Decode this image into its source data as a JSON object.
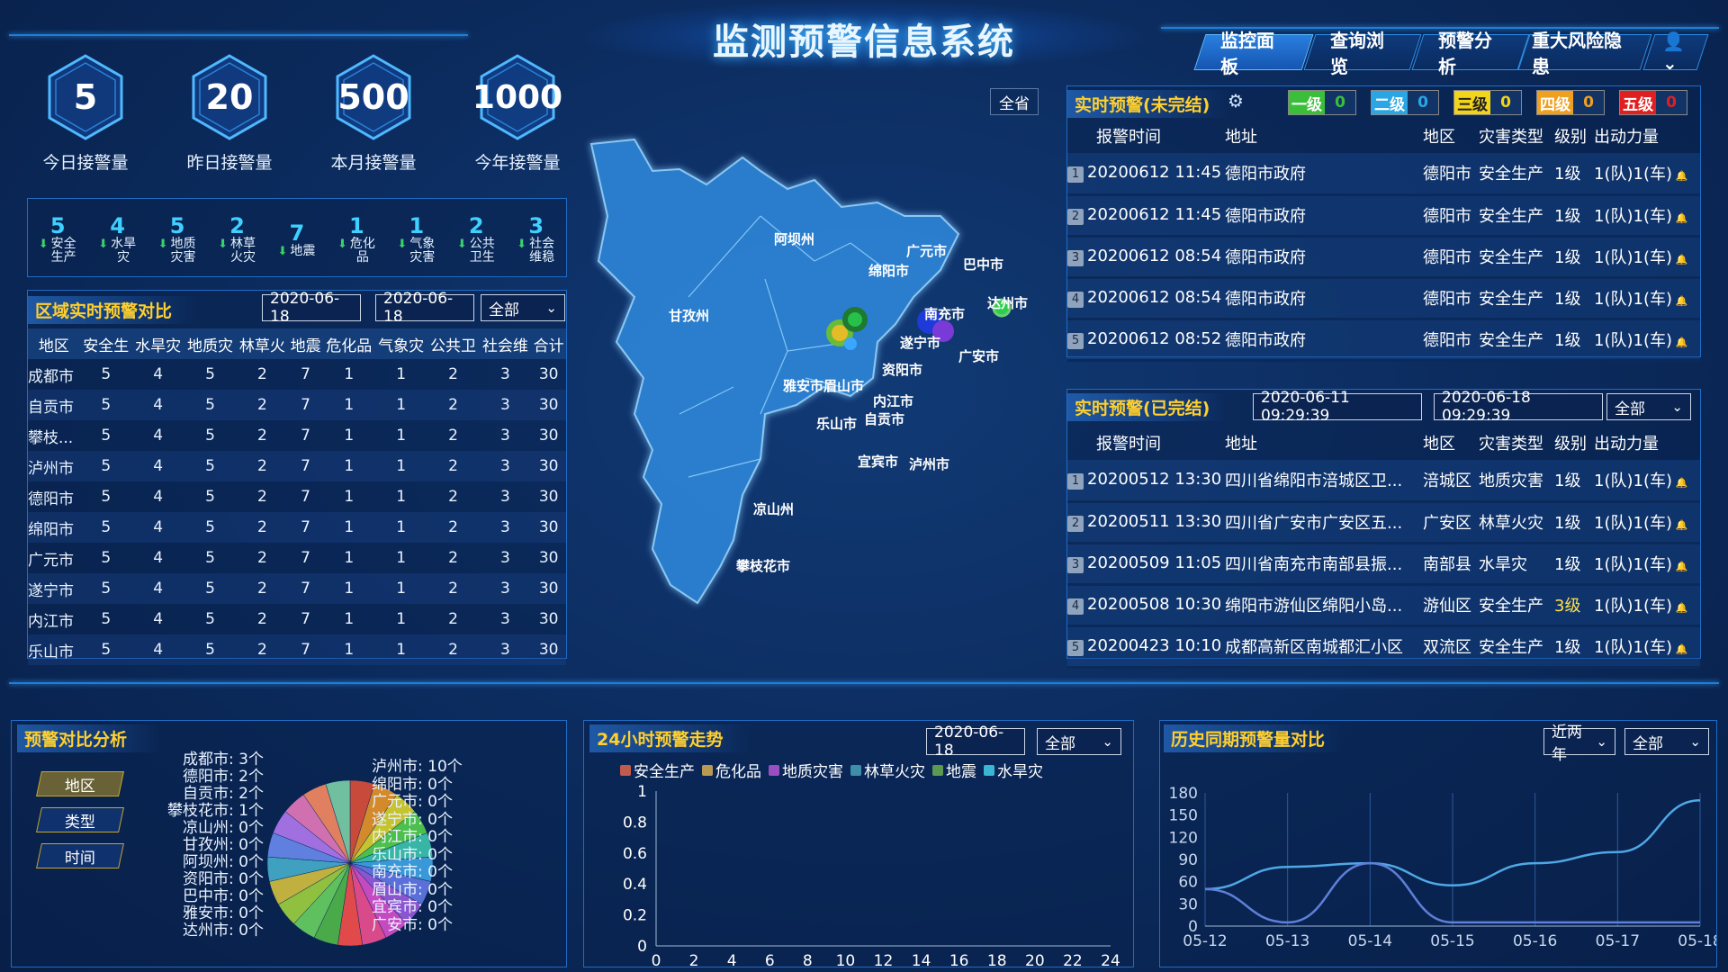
{
  "header": {
    "title": "监测预警信息系统",
    "nav": [
      "监控面板",
      "查询浏览",
      "预警分析",
      "重大风险隐患"
    ],
    "user_icon": "user-icon"
  },
  "kpis": [
    {
      "value": "5",
      "label": "今日接警量"
    },
    {
      "value": "20",
      "label": "昨日接警量"
    },
    {
      "value": "500",
      "label": "本月接警量"
    },
    {
      "value": "1000",
      "label": "今年接警量"
    }
  ],
  "categories": [
    {
      "n": "5",
      "l": "安全生产"
    },
    {
      "n": "4",
      "l": "水旱灾"
    },
    {
      "n": "5",
      "l": "地质灾害"
    },
    {
      "n": "2",
      "l": "林草火灾"
    },
    {
      "n": "7",
      "l": "地震"
    },
    {
      "n": "1",
      "l": "危化品"
    },
    {
      "n": "1",
      "l": "气象灾害"
    },
    {
      "n": "2",
      "l": "公共卫生"
    },
    {
      "n": "3",
      "l": "社会维稳"
    }
  ],
  "region": {
    "title": "区域实时预警对比",
    "date1": "2020-06-18",
    "date2": "2020-06-18",
    "select": "全部",
    "headers": [
      "地区",
      "安全生",
      "水旱灾",
      "地质灾",
      "林草火",
      "地震",
      "危化品",
      "气象灾",
      "公共卫",
      "社会维",
      "合计"
    ],
    "rows": [
      [
        "成都市",
        "5",
        "4",
        "5",
        "2",
        "7",
        "1",
        "1",
        "2",
        "3",
        "30"
      ],
      [
        "自贡市",
        "5",
        "4",
        "5",
        "2",
        "7",
        "1",
        "1",
        "2",
        "3",
        "30"
      ],
      [
        "攀枝...",
        "5",
        "4",
        "5",
        "2",
        "7",
        "1",
        "1",
        "2",
        "3",
        "30"
      ],
      [
        "泸州市",
        "5",
        "4",
        "5",
        "2",
        "7",
        "1",
        "1",
        "2",
        "3",
        "30"
      ],
      [
        "德阳市",
        "5",
        "4",
        "5",
        "2",
        "7",
        "1",
        "1",
        "2",
        "3",
        "30"
      ],
      [
        "绵阳市",
        "5",
        "4",
        "5",
        "2",
        "7",
        "1",
        "1",
        "2",
        "3",
        "30"
      ],
      [
        "广元市",
        "5",
        "4",
        "5",
        "2",
        "7",
        "1",
        "1",
        "2",
        "3",
        "30"
      ],
      [
        "遂宁市",
        "5",
        "4",
        "5",
        "2",
        "7",
        "1",
        "1",
        "2",
        "3",
        "30"
      ],
      [
        "内江市",
        "5",
        "4",
        "5",
        "2",
        "7",
        "1",
        "1",
        "2",
        "3",
        "30"
      ],
      [
        "乐山市",
        "5",
        "4",
        "5",
        "2",
        "7",
        "1",
        "1",
        "2",
        "3",
        "30"
      ]
    ]
  },
  "map": {
    "all_button": "全省",
    "labels": [
      "阿坝州",
      "甘孜州",
      "广元市",
      "巴中市",
      "绵阳市",
      "南充市",
      "达州市",
      "遂宁市",
      "广安市",
      "资阳市",
      "雅安市",
      "眉山市",
      "内江市",
      "乐山市",
      "自贡市",
      "宜宾市",
      "泸州市",
      "凉山州",
      "攀枝花市"
    ]
  },
  "live": {
    "title": "实时预警(未完结)",
    "levels": [
      {
        "name": "一级",
        "count": "0",
        "color": "#3bbf3b"
      },
      {
        "name": "二级",
        "count": "0",
        "color": "#2aa6e6"
      },
      {
        "name": "三级",
        "count": "0",
        "color": "#f2d41a"
      },
      {
        "name": "四级",
        "count": "0",
        "color": "#f0a020"
      },
      {
        "name": "五级",
        "count": "0",
        "color": "#e02020"
      }
    ],
    "headers": [
      "报警时间",
      "地址",
      "地区",
      "灾害类型",
      "级别",
      "出动力量"
    ],
    "rows": [
      [
        "1",
        "20200612 11:45",
        "德阳市政府",
        "德阳市",
        "安全生产",
        "1级",
        "1(队)1(车)"
      ],
      [
        "2",
        "20200612 11:45",
        "德阳市政府",
        "德阳市",
        "安全生产",
        "1级",
        "1(队)1(车)"
      ],
      [
        "3",
        "20200612 08:54",
        "德阳市政府",
        "德阳市",
        "安全生产",
        "1级",
        "1(队)1(车)"
      ],
      [
        "4",
        "20200612 08:54",
        "德阳市政府",
        "德阳市",
        "安全生产",
        "1级",
        "1(队)1(车)"
      ],
      [
        "5",
        "20200612 08:52",
        "德阳市政府",
        "德阳市",
        "安全生产",
        "1级",
        "1(队)1(车)"
      ]
    ]
  },
  "done": {
    "title": "实时预警(已完结)",
    "date1": "2020-06-11 09:29:39",
    "date2": "2020-06-18 09:29:39",
    "select": "全部",
    "headers": [
      "报警时间",
      "地址",
      "地区",
      "灾害类型",
      "级别",
      "出动力量"
    ],
    "rows": [
      [
        "1",
        "20200512 13:30",
        "四川省绵阳市涪城区卫...",
        "涪城区",
        "地质灾害",
        "1级",
        "1(队)1(车)"
      ],
      [
        "2",
        "20200511 13:30",
        "四川省广安市广安区五...",
        "广安区",
        "林草火灾",
        "1级",
        "1(队)1(车)"
      ],
      [
        "3",
        "20200509 11:05",
        "四川省南充市南部县振...",
        "南部县",
        "水旱灾",
        "1级",
        "1(队)1(车)"
      ],
      [
        "4",
        "20200508 10:30",
        "绵阳市游仙区绵阳小岛...",
        "游仙区",
        "安全生产",
        "3级",
        "1(队)1(车)"
      ],
      [
        "5",
        "20200423 10:10",
        "成都高新区南城都汇小区",
        "双流区",
        "安全生产",
        "1级",
        "1(队)1(车)"
      ]
    ]
  },
  "compare": {
    "title": "预警对比分析",
    "buttons": [
      "地区",
      "类型",
      "时间"
    ],
    "left": [
      "成都市: 3个",
      "德阳市: 2个",
      "自贡市: 2个",
      "攀枝花市: 1个",
      "凉山州: 0个",
      "甘孜州: 0个",
      "阿坝州: 0个",
      "资阳市: 0个",
      "巴中市: 0个",
      "雅安市: 0个",
      "达州市: 0个"
    ],
    "right": [
      "泸州市: 10个",
      "绵阳市: 0个",
      "广元市: 0个",
      "遂宁市: 0个",
      "内江市: 0个",
      "乐山市: 0个",
      "南充市: 0个",
      "眉山市: 0个",
      "宜宾市: 0个",
      "广安市: 0个"
    ]
  },
  "trend24": {
    "title": "24小时预警走势",
    "date": "2020-06-18",
    "select": "全部"
  },
  "history": {
    "title": "历史同期预警量对比",
    "select1": "近两年",
    "select2": "全部"
  },
  "chart_data": [
    {
      "type": "pie",
      "title": "预警对比分析",
      "categories": [
        "成都市",
        "德阳市",
        "自贡市",
        "攀枝花市",
        "凉山州",
        "甘孜州",
        "阿坝州",
        "资阳市",
        "巴中市",
        "雅安市",
        "达州市",
        "泸州市",
        "绵阳市",
        "广元市",
        "遂宁市",
        "内江市",
        "乐山市",
        "南充市",
        "眉山市",
        "宜宾市",
        "广安市"
      ],
      "values": [
        3,
        2,
        2,
        1,
        0,
        0,
        0,
        0,
        0,
        0,
        0,
        10,
        0,
        0,
        0,
        0,
        0,
        0,
        0,
        0,
        0
      ],
      "colors": [
        "#c84a3a",
        "#d28a2a",
        "#c6c330",
        "#4cbf4c",
        "#37b6a6",
        "#3a98d8",
        "#5a6fd8",
        "#8a55cf",
        "#c44ac1",
        "#d84a8a",
        "#e04a4a",
        "#4aaa4a",
        "#5fc05f",
        "#90c040",
        "#c0b040",
        "#40a0c0",
        "#6080e0",
        "#a070e0",
        "#d070b0",
        "#e08060",
        "#70c0a0"
      ]
    },
    {
      "type": "line",
      "title": "24小时预警走势",
      "x": [
        0,
        2,
        4,
        6,
        8,
        10,
        12,
        14,
        16,
        18,
        20,
        22,
        24
      ],
      "ylim": [
        0,
        1
      ],
      "yticks": [
        0,
        0.2,
        0.4,
        0.6,
        0.8,
        1
      ],
      "series": [
        {
          "name": "安全生产",
          "color": "#c35a4e",
          "values": []
        },
        {
          "name": "危化品",
          "color": "#b99a53",
          "values": []
        },
        {
          "name": "地质灾害",
          "color": "#9a4fc0",
          "values": []
        },
        {
          "name": "林草火灾",
          "color": "#3f8ea8",
          "values": []
        },
        {
          "name": "地震",
          "color": "#5c9a52",
          "values": []
        },
        {
          "name": "水旱灾",
          "color": "#3ab6d4",
          "values": []
        }
      ]
    },
    {
      "type": "line",
      "title": "历史同期预警量对比",
      "categories": [
        "05-12",
        "05-13",
        "05-14",
        "05-15",
        "05-16",
        "05-17",
        "05-18"
      ],
      "ylim": [
        0,
        180
      ],
      "yticks": [
        0,
        30,
        60,
        90,
        120,
        150,
        180
      ],
      "series": [
        {
          "name": "",
          "color": "#4fa8e6",
          "values": [
            50,
            80,
            85,
            55,
            85,
            100,
            170
          ]
        },
        {
          "name": "",
          "color": "#5f7fd8",
          "values": [
            50,
            5,
            85,
            5,
            5,
            5,
            5
          ]
        }
      ]
    }
  ]
}
